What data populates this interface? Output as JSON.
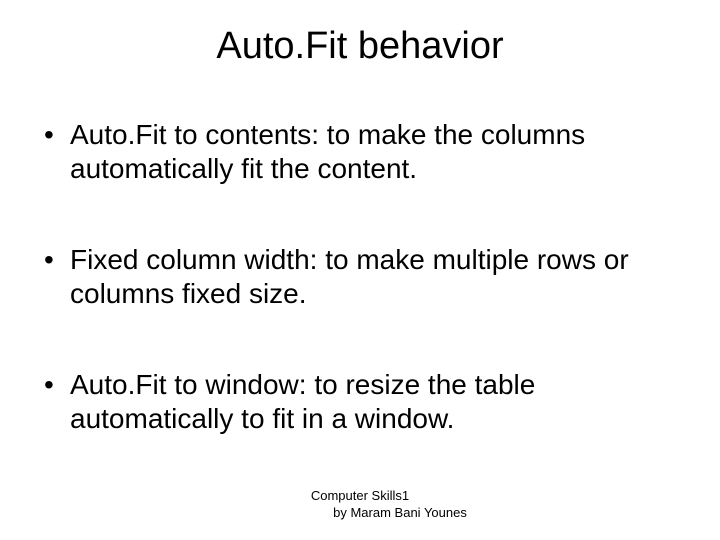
{
  "title": "Auto.Fit behavior",
  "bullets": [
    "Auto.Fit to contents: to make the columns automatically fit the content.",
    "Fixed column width: to make multiple rows or columns fixed size.",
    "Auto.Fit to window: to resize the table automatically to fit in a window."
  ],
  "footer": {
    "line1": "Computer Skills1",
    "line2": "by Maram Bani Younes"
  }
}
